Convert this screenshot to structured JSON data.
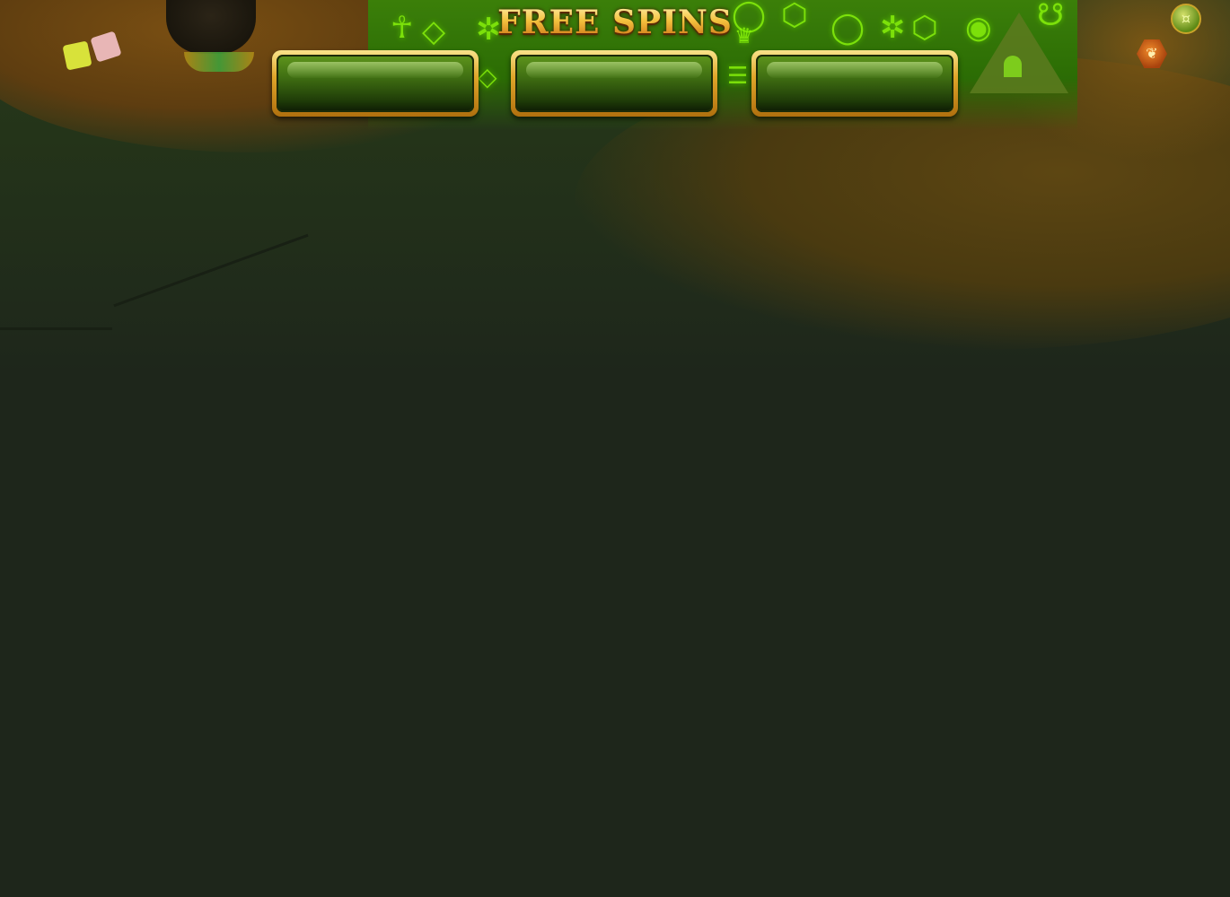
{
  "game": {
    "title": "FREE SPINS",
    "counters": [
      {
        "label": "",
        "value": ""
      },
      {
        "label": "",
        "value": ""
      },
      {
        "label": "",
        "value": ""
      }
    ]
  },
  "decor": {
    "glyphs": [
      "♦",
      "☥",
      "◆",
      "⬡",
      "♛",
      "☼",
      "✦",
      "⌘",
      "♜",
      "☉"
    ],
    "colors": {
      "background": "#1e261b",
      "glyph_green": "#8ff01c",
      "title_gold": "#f4c23e",
      "panel_green": "#3f6e12",
      "panel_frame_gold": "#e0a62a"
    }
  },
  "icons": {
    "top_right_button": "coin-icon",
    "side_badge": "scarab-badge-icon"
  }
}
